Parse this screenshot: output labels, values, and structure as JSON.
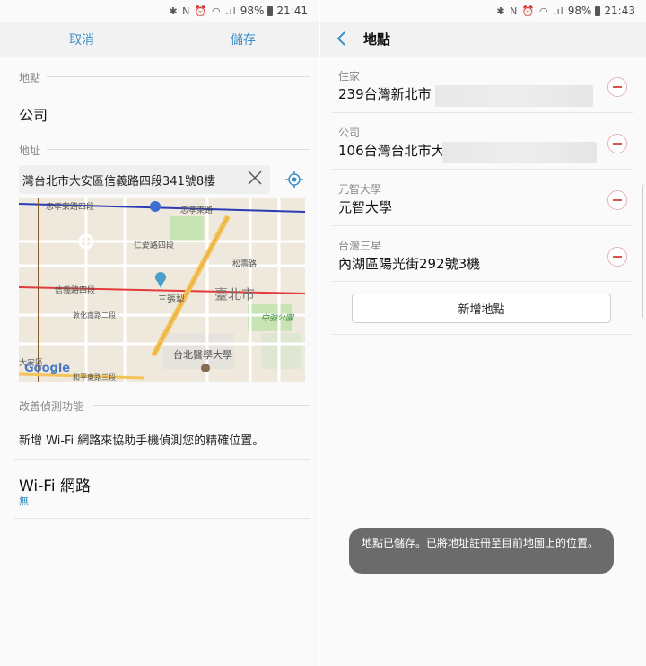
{
  "left": {
    "status": {
      "icons": "✱ N ⏰ ◠ .ıl",
      "battery": "98%",
      "time": "21:41"
    },
    "appbar": {
      "cancel": "取消",
      "save": "儲存"
    },
    "place_section": {
      "label": "地點",
      "value": "公司"
    },
    "address_section": {
      "label": "地址",
      "value": "灣台北市大安區信義路四段341號8樓"
    },
    "map": {
      "labels": [
        "忠孝東路四段",
        "忠孝東路",
        "仁愛路四段",
        "松壽路",
        "信義路四段",
        "三張犁",
        "臺北市",
        "中強公園",
        "敦化南路二段",
        "台北醫學大學",
        "大安區",
        "和平東路三段"
      ],
      "brand": "Google"
    },
    "improve_section": {
      "label": "改善偵測功能",
      "hint": "新增 Wi-Fi 網路來協助手機偵測您的精確位置。"
    },
    "wifi": {
      "title": "Wi-Fi 網路",
      "value": "無"
    }
  },
  "right": {
    "status": {
      "icons": "✱ N ⏰ ◠ .ıl",
      "battery": "98%",
      "time": "21:43"
    },
    "title": "地點",
    "places": [
      {
        "label": "住家",
        "address": "239台灣新北市"
      },
      {
        "label": "公司",
        "address": "106台灣台北市大"
      },
      {
        "label": "元智大學",
        "address": "元智大學"
      },
      {
        "label": "台灣三星",
        "address": "內湖區陽光街292號3機"
      }
    ],
    "add_button": "新增地點",
    "toast": "地點已儲存。已將地址註冊至目前地圖上的位置。"
  },
  "colors": {
    "accent": "#3c8fc6",
    "remove": "#d9534f",
    "toast_bg": "#6b6b6b"
  }
}
